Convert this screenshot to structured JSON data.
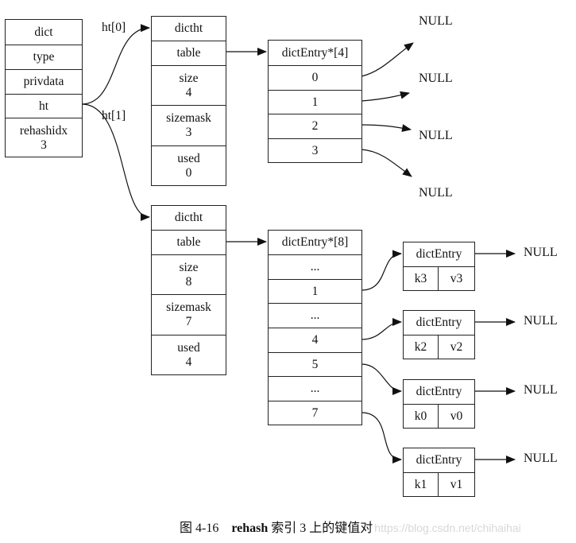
{
  "dict": {
    "fields": [
      "dict",
      "type",
      "privdata",
      "ht"
    ],
    "rehashidx_label": "rehashidx",
    "rehashidx_value": "3"
  },
  "edge_labels": {
    "ht0": "ht[0]",
    "ht1": "ht[1]"
  },
  "ht0": {
    "title": "dictht",
    "table": "table",
    "size_label": "size",
    "size_value": "4",
    "sizemask_label": "sizemask",
    "sizemask_value": "3",
    "used_label": "used",
    "used_value": "0"
  },
  "ht1": {
    "title": "dictht",
    "table": "table",
    "size_label": "size",
    "size_value": "8",
    "sizemask_label": "sizemask",
    "sizemask_value": "7",
    "used_label": "used",
    "used_value": "4"
  },
  "array4": {
    "title": "dictEntry*[4]",
    "slots": [
      "0",
      "1",
      "2",
      "3"
    ]
  },
  "array8": {
    "title": "dictEntry*[8]",
    "slots": [
      "...",
      "1",
      "...",
      "4",
      "5",
      "...",
      "7"
    ]
  },
  "null_label": "NULL",
  "entries": [
    {
      "title": "dictEntry",
      "key": "k3",
      "value": "v3",
      "from_slot": "1"
    },
    {
      "title": "dictEntry",
      "key": "k2",
      "value": "v2",
      "from_slot": "4"
    },
    {
      "title": "dictEntry",
      "key": "k0",
      "value": "v0",
      "from_slot": "5"
    },
    {
      "title": "dictEntry",
      "key": "k1",
      "value": "v1",
      "from_slot": "7"
    }
  ],
  "caption": {
    "figure": "图 4-16",
    "bold": "rehash",
    "text": "索引 3 上的键值对",
    "watermark": "https://blog.csdn.net/chihaihai"
  }
}
